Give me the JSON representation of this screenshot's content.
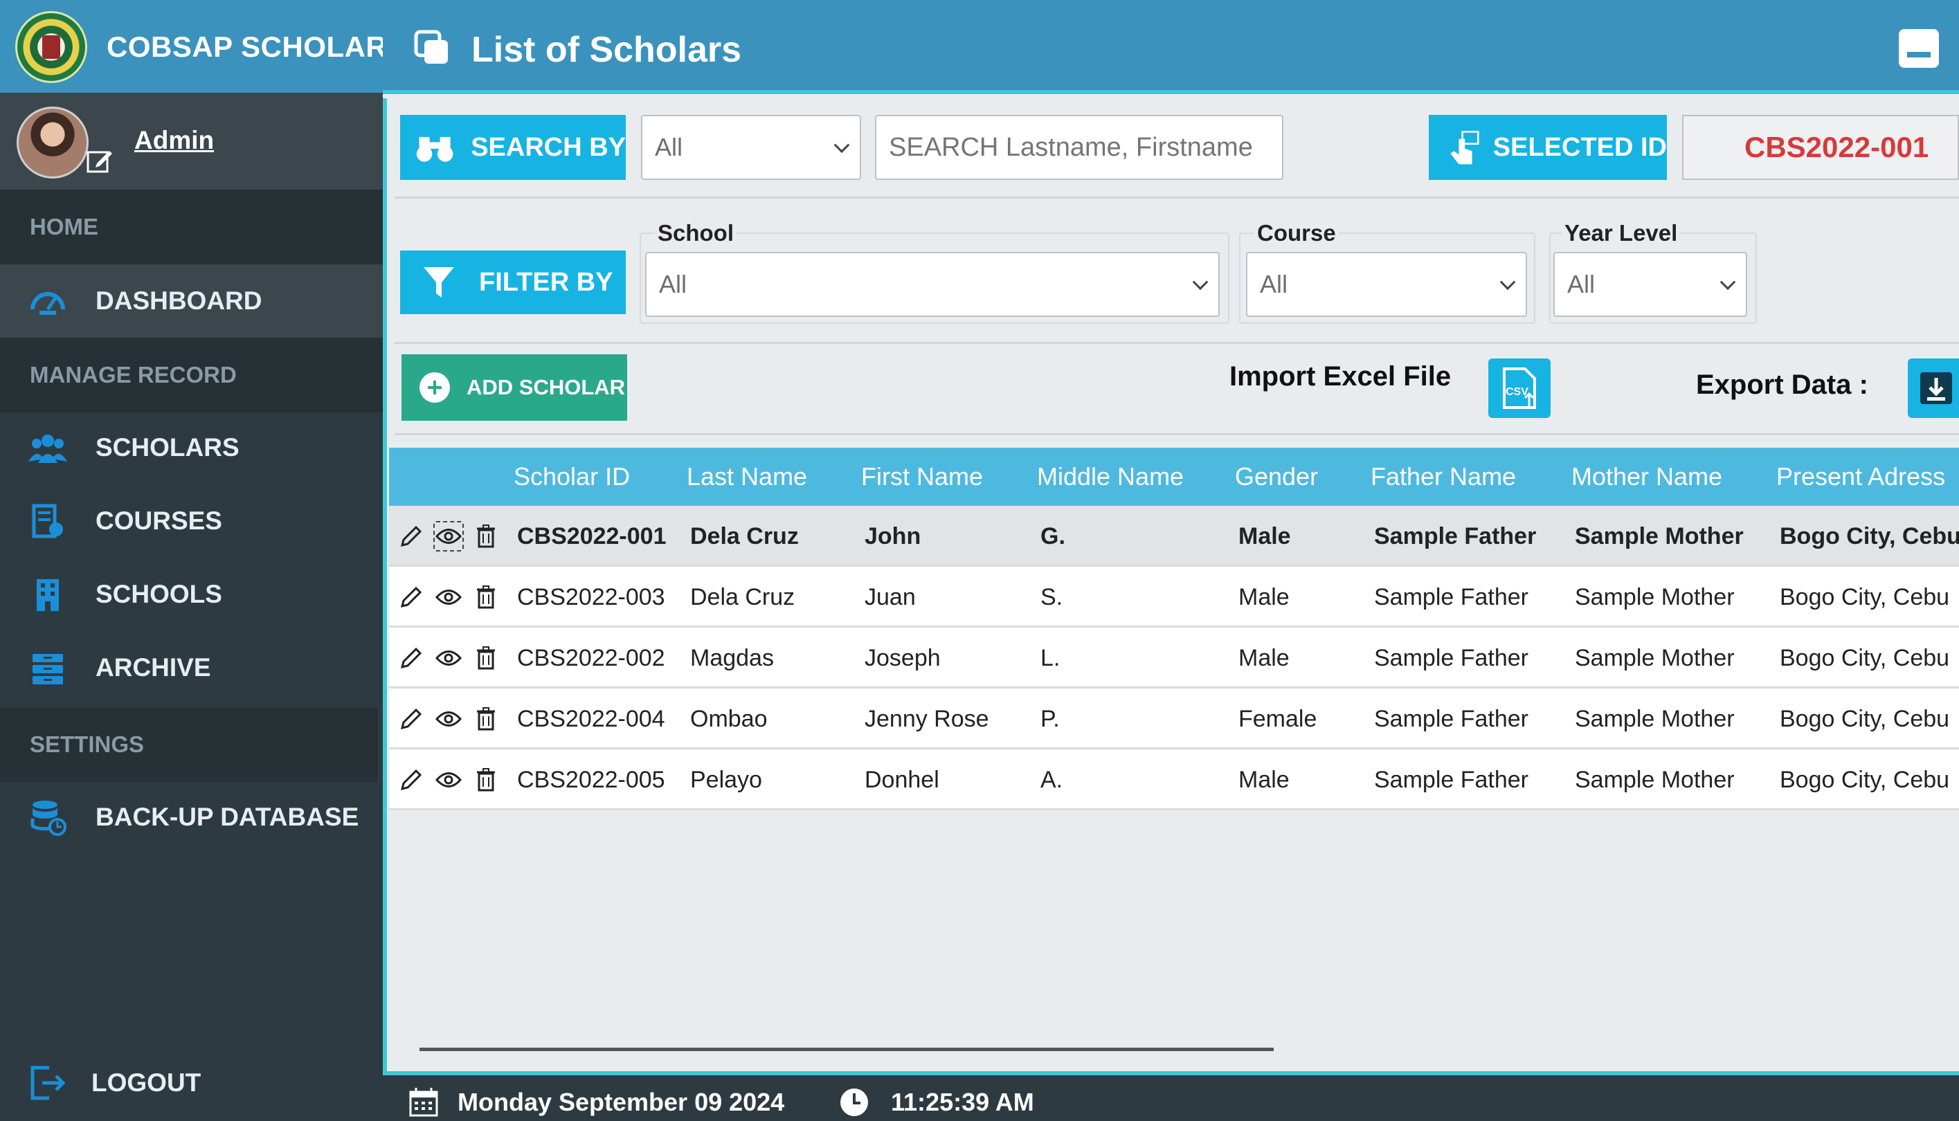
{
  "brand": {
    "title": "COBSAP SCHOLAR"
  },
  "profile": {
    "name": "Admin"
  },
  "sidebar": {
    "sections": [
      "HOME",
      "MANAGE RECORD",
      "SETTINGS"
    ],
    "items": [
      {
        "label": "DASHBOARD",
        "icon": "dashboard-icon"
      },
      {
        "label": "SCHOLARS",
        "icon": "users-icon"
      },
      {
        "label": "COURSES",
        "icon": "courses-icon"
      },
      {
        "label": "SCHOOLS",
        "icon": "building-icon"
      },
      {
        "label": "ARCHIVE",
        "icon": "archive-icon"
      },
      {
        "label": "BACK-UP DATABASE",
        "icon": "database-icon"
      }
    ],
    "logout": "LOGOUT"
  },
  "header": {
    "title": "List of Scholars"
  },
  "search": {
    "button_label": "SEARCH BY",
    "by_value": "All",
    "placeholder": "SEARCH Lastname, Firstname",
    "selected_label": "SELECTED ID",
    "selected_value": "CBS2022-001"
  },
  "filter": {
    "button_label": "FILTER BY",
    "school_label": "School",
    "school_value": "All",
    "course_label": "Course",
    "course_value": "All",
    "year_label": "Year Level",
    "year_value": "All"
  },
  "actions": {
    "add_label": "ADD SCHOLAR",
    "import_label": "Import Excel File",
    "export_label": "Export Data :"
  },
  "table": {
    "columns": [
      "Scholar ID",
      "Last Name",
      "First Name",
      "Middle Name",
      "Gender",
      "Father Name",
      "Mother Name",
      "Present Adress"
    ],
    "rows": [
      [
        "CBS2022-001",
        "Dela Cruz",
        "John",
        "G.",
        "Male",
        "Sample Father",
        "Sample Mother",
        "Bogo City, Cebu"
      ],
      [
        "CBS2022-003",
        "Dela Cruz",
        "Juan",
        "S.",
        "Male",
        "Sample Father",
        "Sample Mother",
        "Bogo City, Cebu"
      ],
      [
        "CBS2022-002",
        "Magdas",
        "Joseph",
        "L.",
        "Male",
        "Sample Father",
        "Sample Mother",
        "Bogo City, Cebu"
      ],
      [
        "CBS2022-004",
        "Ombao",
        "Jenny Rose",
        "P.",
        "Female",
        "Sample Father",
        "Sample Mother",
        "Bogo City, Cebu"
      ],
      [
        "CBS2022-005",
        "Pelayo",
        "Donhel",
        "A.",
        "Male",
        "Sample Father",
        "Sample Mother",
        "Bogo City, Cebu"
      ]
    ]
  },
  "footer": {
    "date": "Monday September 09 2024",
    "time": "11:25:39 AM"
  },
  "colors": {
    "accent": "#3a92bd",
    "button": "#17b3e3",
    "add_button": "#2aa88a",
    "sidebar": "#2e3a41",
    "selected_id": "#d63a3a"
  }
}
